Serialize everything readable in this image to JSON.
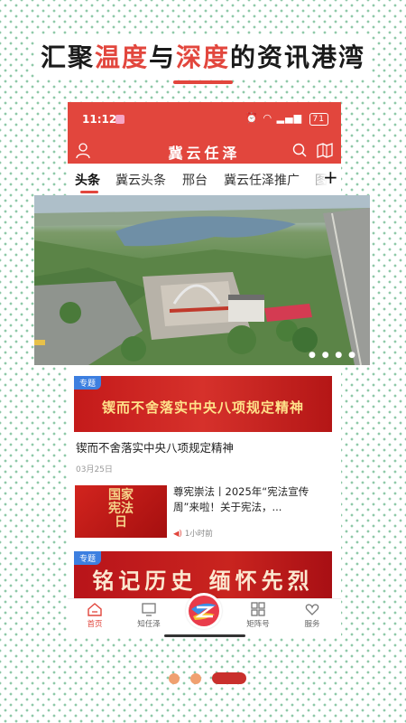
{
  "promo": {
    "headline_1": "汇聚",
    "headline_2": "温度",
    "headline_3": "与",
    "headline_4": "深度",
    "headline_5": "的资讯港湾"
  },
  "status_bar": {
    "time": "11:12",
    "battery": "71"
  },
  "app": {
    "logo_text": "冀云任泽"
  },
  "tabs": [
    {
      "label": "头条",
      "active": true
    },
    {
      "label": "冀云头条",
      "active": false
    },
    {
      "label": "邢台",
      "active": false
    },
    {
      "label": "冀云任泽推广",
      "active": false
    },
    {
      "label": "图",
      "active": false
    }
  ],
  "feed": {
    "card1": {
      "tag": "专题",
      "banner_text": "锲而不舍落实中央八项规定精神",
      "title": "锲而不舍落实中央八项规定精神",
      "date": "03月25日"
    },
    "card2": {
      "image_text_1": "国",
      "image_text_2": "家",
      "image_text_3": "宪",
      "image_text_4": "法",
      "image_text_5": "日",
      "title": "尊宪崇法丨2025年“宪法宣传周”来啦！关于宪法，...",
      "meta": "1小时前"
    },
    "card3": {
      "tag": "专题",
      "banner_text": "铭记历史 缅怀先烈"
    }
  },
  "bottom_nav": [
    {
      "label": "首页",
      "active": true
    },
    {
      "label": "知任泽",
      "active": false
    },
    {
      "label": "矩阵号",
      "active": false
    },
    {
      "label": "服务",
      "active": false
    }
  ],
  "colors": {
    "accent": "#e2463d",
    "tag_blue": "#3d7fe0"
  },
  "carousel": {
    "pages": 3,
    "active_index": 2
  }
}
